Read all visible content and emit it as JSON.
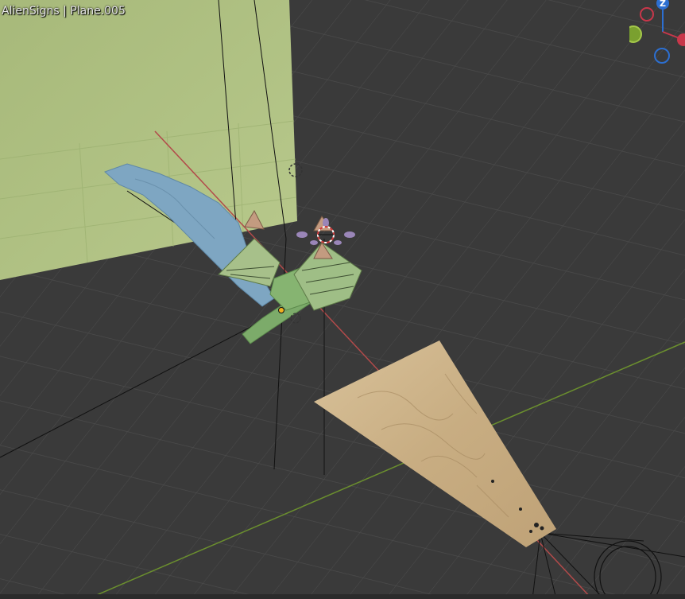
{
  "viewport": {
    "header_text": "AlienSigns | Plane.005"
  },
  "gizmo": {
    "z_label": "Z",
    "colors": {
      "x": "#c8374a",
      "y": "#7aa02f",
      "z": "#2c6fd1"
    }
  },
  "colors": {
    "background": "#3a3a3a",
    "grid": "#4a4a4a",
    "wall": "#a9bc7f",
    "sand": "#cdb38a",
    "water": "#7ea6c2",
    "structure": "#7cab6a",
    "pyramid": "#b9967a"
  }
}
